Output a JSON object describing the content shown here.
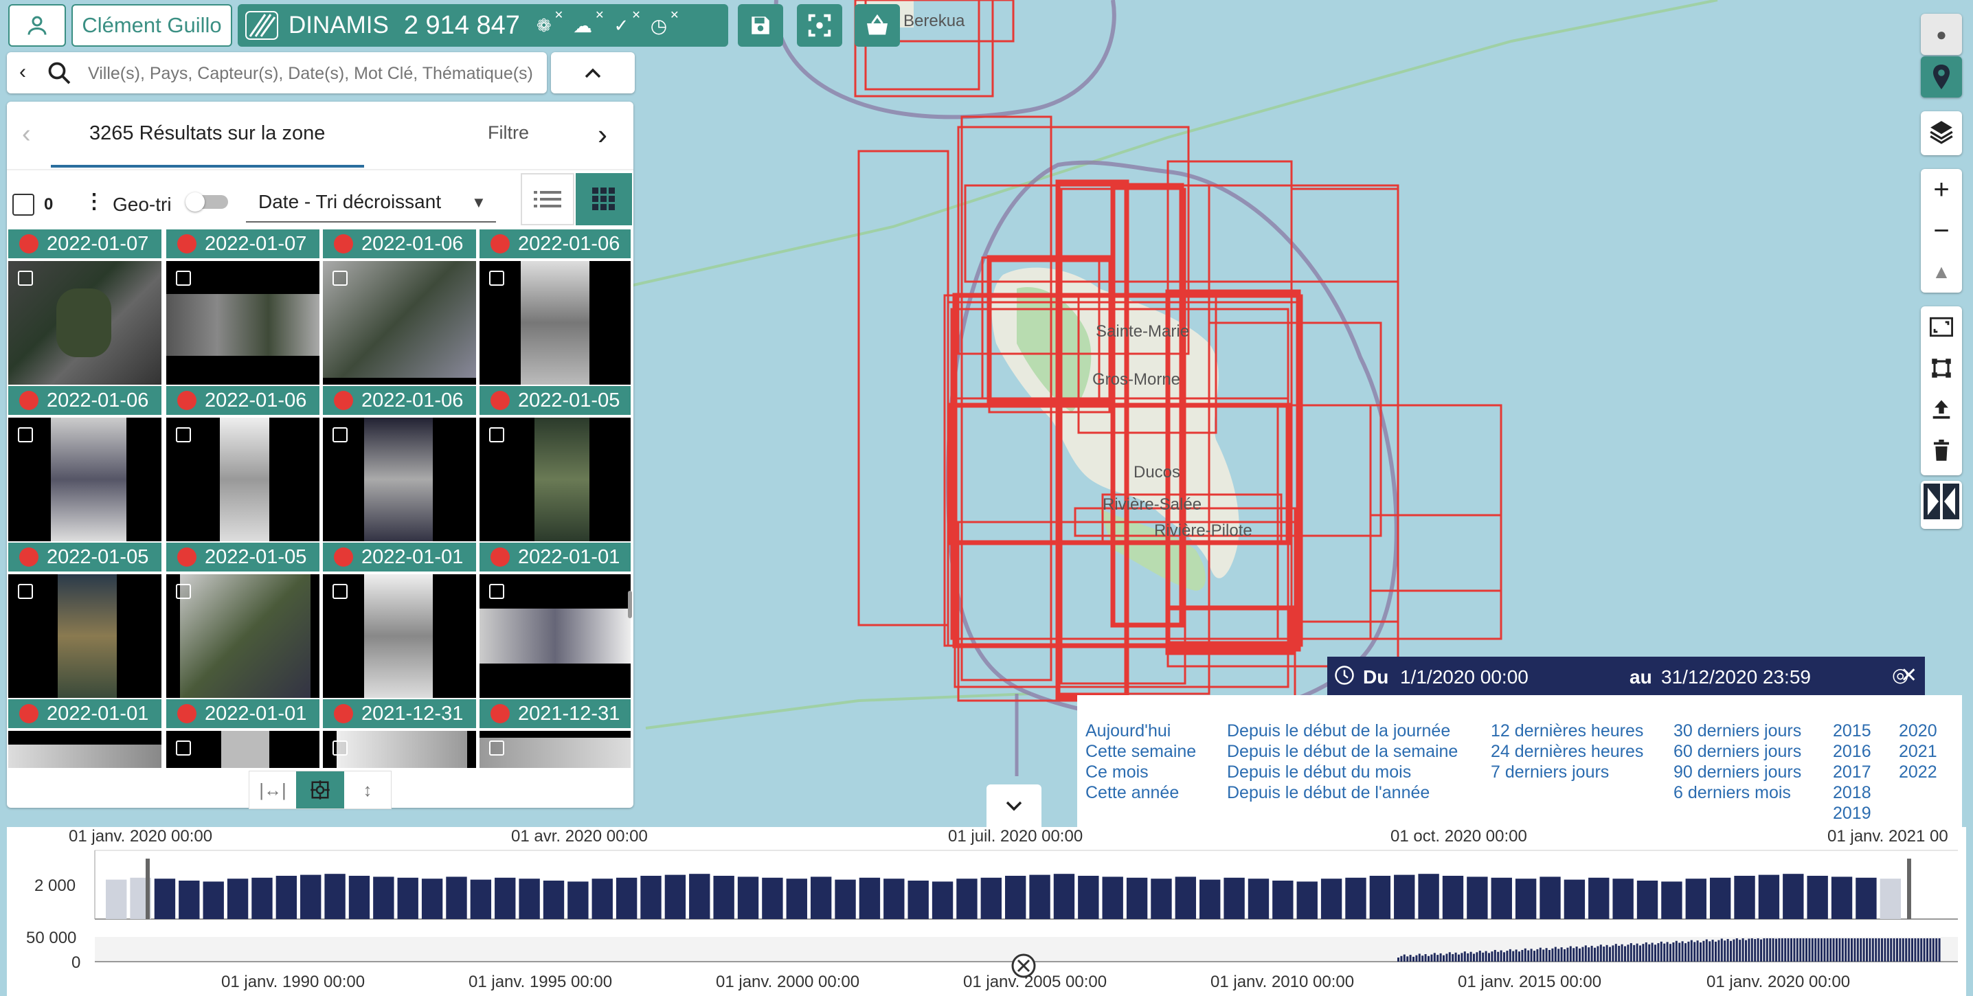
{
  "header": {
    "user_name": "Clément Guillo",
    "brand": "DINAMIS",
    "count": "2 914 847"
  },
  "search": {
    "placeholder": "Ville(s), Pays, Capteur(s), Date(s), Mot Clé, Thématique(s)"
  },
  "results": {
    "title": "3265 Résultats sur la zone",
    "filter_tab": "Filtre",
    "selected_count": "0",
    "geosort_label": "Geo-tri",
    "sort_value": "Date - Tri décroissant"
  },
  "tiles": {
    "row_dates": [
      [
        "2022-01-07",
        "2022-01-07",
        "2022-01-06",
        "2022-01-06"
      ],
      [
        "2022-01-06",
        "2022-01-06",
        "2022-01-06",
        "2022-01-05"
      ],
      [
        "2022-01-05",
        "2022-01-05",
        "2022-01-01",
        "2022-01-01"
      ],
      [
        "2022-01-01",
        "2022-01-01",
        "2021-12-31",
        "2021-12-31"
      ]
    ]
  },
  "map_labels": {
    "berekua": "Berekua",
    "sainte_marie": "Sainte-Marie",
    "gros_morne": "Gros-Morne",
    "ducos": "Ducos",
    "riviere_salee": "Rivière-Salée",
    "riviere_pilote": "Rivière-Pilote"
  },
  "date_panel": {
    "from_label": "Du",
    "from_value": "1/1/2020 00:00",
    "to_label": "au",
    "to_value": "31/12/2020 23:59",
    "col1": [
      "Aujourd'hui",
      "Cette semaine",
      "Ce mois",
      "Cette année"
    ],
    "col2": [
      "Depuis le début de la journée",
      "Depuis le début de la semaine",
      "Depuis le début du mois",
      "Depuis le début de l'année"
    ],
    "col3": [
      "12 dernières heures",
      "24 dernières heures",
      "7 derniers jours"
    ],
    "col4": [
      "30 derniers jours",
      "60 derniers jours",
      "90 derniers jours",
      "6 derniers mois"
    ],
    "col5": [
      "2015",
      "2016",
      "2017",
      "2018",
      "2019"
    ],
    "col6": [
      "2020",
      "2021",
      "2022"
    ]
  },
  "timeline": {
    "top_axis": [
      "01 janv. 2020 00:00",
      "01 avr. 2020 00:00",
      "01 juil. 2020 00:00",
      "01 oct. 2020 00:00",
      "01 janv. 2021 00"
    ],
    "top_y_tick": "2 000",
    "bottom_y_ticks": [
      "50 000",
      "0"
    ],
    "bottom_axis": [
      "01 janv. 1990 00:00",
      "01 janv. 1995 00:00",
      "01 janv. 2000 00:00",
      "01 janv. 2005 00:00",
      "01 janv. 2010 00:00",
      "01 janv. 2015 00:00",
      "01 janv. 2020 00:00"
    ]
  },
  "colors": {
    "accent": "#3a8f83",
    "footprint": "#e53935",
    "bar": "#1f2a5c",
    "sea": "#aad3df"
  }
}
